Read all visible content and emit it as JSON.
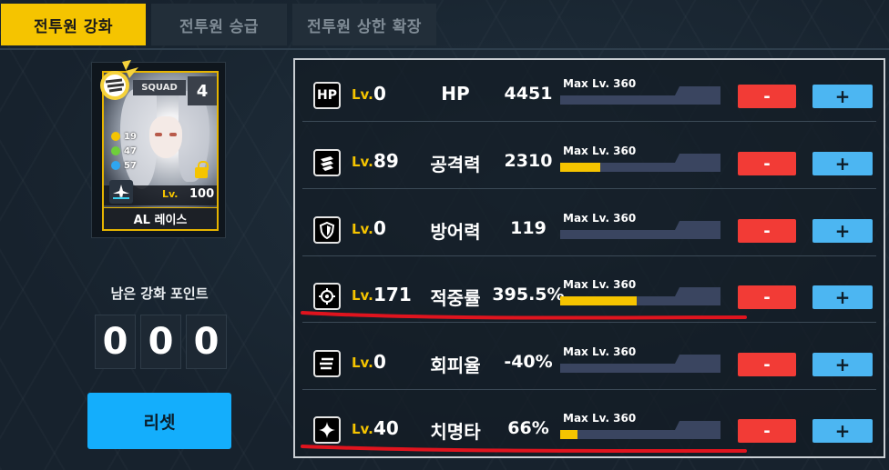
{
  "tabs": [
    {
      "label": "전투원 강화",
      "active": true
    },
    {
      "label": "전투원 승급",
      "active": false
    },
    {
      "label": "전투원 상한 확장",
      "active": false
    }
  ],
  "card": {
    "squad_label": "SQUAD",
    "squad_number": "4",
    "stats": [
      "19",
      "47",
      "57"
    ],
    "level_label": "Lv.",
    "level": "100",
    "name": "AL 레이스"
  },
  "points": {
    "label": "남은 강화 포인트",
    "digits": [
      "0",
      "0",
      "0"
    ]
  },
  "reset_label": "리셋",
  "rows": [
    {
      "icon": "hp-icon",
      "icon_text": "HP",
      "lv_label": "Lv.",
      "lv": "0",
      "name": "HP",
      "value": "4451",
      "max_label": "Max Lv. 360",
      "progress": 0.0
    },
    {
      "icon": "attack-icon",
      "icon_text": "",
      "lv_label": "Lv.",
      "lv": "89",
      "name": "공격력",
      "value": "2310",
      "max_label": "Max Lv. 360",
      "progress": 0.247
    },
    {
      "icon": "shield-icon",
      "icon_text": "",
      "lv_label": "Lv.",
      "lv": "0",
      "name": "방어력",
      "value": "119",
      "max_label": "Max Lv. 360",
      "progress": 0.0
    },
    {
      "icon": "crosshair-icon",
      "icon_text": "",
      "lv_label": "Lv.",
      "lv": "171",
      "name": "적중률",
      "value": "395.5%",
      "max_label": "Max Lv. 360",
      "progress": 0.475
    },
    {
      "icon": "evasion-icon",
      "icon_text": "",
      "lv_label": "Lv.",
      "lv": "0",
      "name": "회피율",
      "value": "-40%",
      "max_label": "Max Lv. 360",
      "progress": 0.0
    },
    {
      "icon": "critical-icon",
      "icon_text": "",
      "lv_label": "Lv.",
      "lv": "40",
      "name": "치명타",
      "value": "66%",
      "max_label": "Max Lv. 360",
      "progress": 0.111
    }
  ],
  "minus_label": "-",
  "plus_label": "+",
  "colors": {
    "accent": "#f5c400",
    "minus": "#f23b36",
    "plus": "#4cb6f2",
    "reset": "#14aefc",
    "annotation": "#e0141e"
  }
}
